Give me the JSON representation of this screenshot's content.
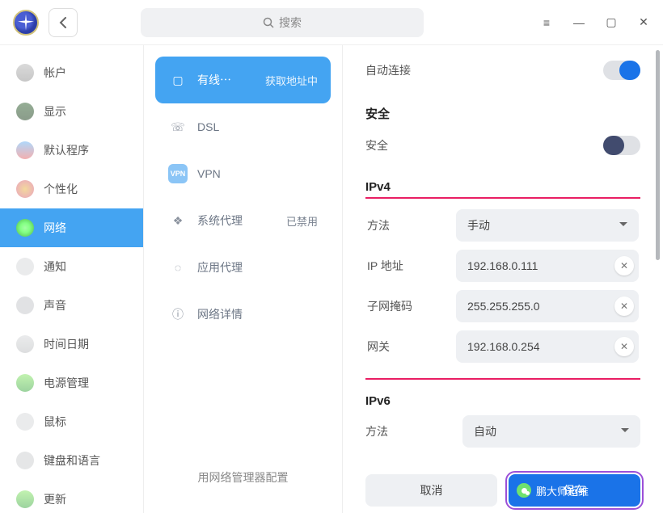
{
  "search_placeholder": "搜索",
  "sidebar": [
    {
      "key": "account",
      "label": "帐户",
      "icon_bg": "linear-gradient(#bbb,#999)"
    },
    {
      "key": "display",
      "label": "显示",
      "icon_bg": "linear-gradient(#3e6b3e,#2a4a2a)"
    },
    {
      "key": "default",
      "label": "默认程序",
      "icon_bg": "linear-gradient(#6fb7f5,#e86f6f)"
    },
    {
      "key": "personalize",
      "label": "个性化",
      "icon_bg": "radial-gradient(circle,#e8b84c,#d85a8a)"
    },
    {
      "key": "network",
      "label": "网络",
      "icon_bg": "radial-gradient(circle,#7fe87f,#3a8a3a)"
    },
    {
      "key": "notify",
      "label": "通知",
      "icon_bg": "#d9dbdd"
    },
    {
      "key": "sound",
      "label": "声音",
      "icon_bg": "#c9cbcd"
    },
    {
      "key": "datetime",
      "label": "时间日期",
      "icon_bg": "linear-gradient(#d9dbdd,#c0c2c4)"
    },
    {
      "key": "power",
      "label": "电源管理",
      "icon_bg": "linear-gradient(#8fe86f,#4caf50)"
    },
    {
      "key": "mouse",
      "label": "鼠标",
      "icon_bg": "#d9dbdd"
    },
    {
      "key": "keyboard",
      "label": "键盘和语言",
      "icon_bg": "#cfd1d4"
    },
    {
      "key": "update",
      "label": "更新",
      "icon_bg": "linear-gradient(#8fe86f,#4caf50)"
    }
  ],
  "active_sidebar": "network",
  "network_tabs": [
    {
      "key": "wired",
      "label": "有线⋯",
      "status": "获取地址中",
      "icon": "▢"
    },
    {
      "key": "dsl",
      "label": "DSL",
      "icon": "☏"
    },
    {
      "key": "vpn",
      "label": "VPN",
      "icon": "VPN",
      "box": true
    },
    {
      "key": "sysproxy",
      "label": "系统代理",
      "status": "已禁用",
      "icon": "❖"
    },
    {
      "key": "appproxy",
      "label": "应用代理",
      "icon": "◌"
    },
    {
      "key": "netdetail",
      "label": "网络详情",
      "icon": "ⓘ"
    }
  ],
  "active_tab": "wired",
  "mid_footer": "用网络管理器配置",
  "detail": {
    "auto_connect": "自动连接",
    "security_h": "安全",
    "security_label": "安全",
    "ipv4_h": "IPv4",
    "method_label": "方法",
    "method_value": "手动",
    "ip_label": "IP 地址",
    "ip_value": "192.168.0.111",
    "mask_label": "子网掩码",
    "mask_value": "255.255.255.0",
    "gw_label": "网关",
    "gw_value": "192.168.0.254",
    "ipv6_h": "IPv6",
    "ipv6_method_label": "方法",
    "ipv6_method_value": "自动",
    "cancel": "取消",
    "save": "保存",
    "watermark": "鹏大师运维"
  }
}
